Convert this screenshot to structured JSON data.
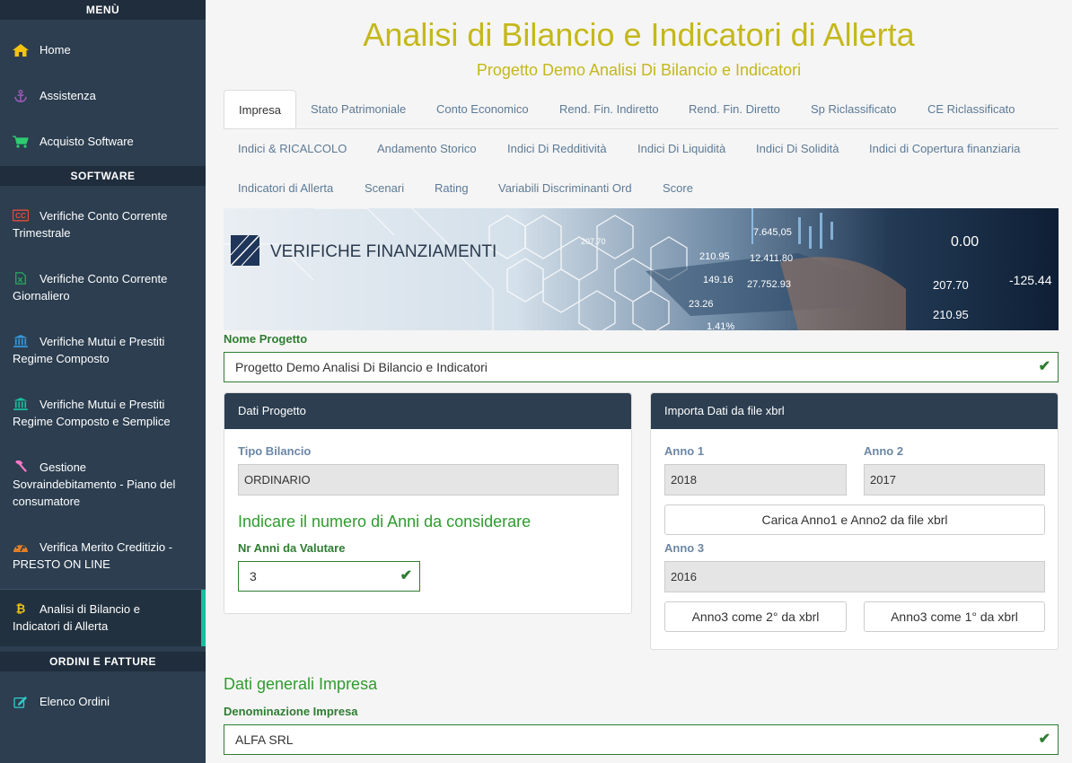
{
  "sidebar": {
    "menu_heading": "MENÙ",
    "software_heading": "SOFTWARE",
    "orders_heading": "ORDINI E FATTURE",
    "items": [
      {
        "label": "Home",
        "icon": "home-icon"
      },
      {
        "label": "Assistenza",
        "icon": "anchor-icon"
      },
      {
        "label": "Acquisto Software",
        "icon": "cart-icon"
      },
      {
        "label": "Verifiche Conto Corrente Trimestrale",
        "icon": "cc-icon"
      },
      {
        "label": "Verifiche Conto Corrente Giornaliero",
        "icon": "excel-icon"
      },
      {
        "label": "Verifiche Mutui e Prestiti Regime Composto",
        "icon": "bank-icon"
      },
      {
        "label": "Verifiche Mutui e Prestiti Regime Composto e Semplice",
        "icon": "bank-icon"
      },
      {
        "label": "Gestione Sovraindebitamento - Piano del consumatore",
        "icon": "gavel-icon"
      },
      {
        "label": "Verifica Merito Creditizio - PRESTO ON LINE",
        "icon": "dashboard-icon"
      },
      {
        "label": "Analisi di Bilancio e Indicatori di Allerta",
        "icon": "bitcoin-icon"
      },
      {
        "label": "Elenco Ordini",
        "icon": "edit-icon"
      }
    ]
  },
  "header": {
    "title": "Analisi di Bilancio e Indicatori di Allerta",
    "subtitle": "Progetto Demo Analisi Di Bilancio e Indicatori"
  },
  "tabs": [
    "Impresa",
    "Stato Patrimoniale",
    "Conto Economico",
    "Rend. Fin. Indiretto",
    "Rend. Fin. Diretto",
    "Sp Riclassificato",
    "CE Riclassificato",
    "Indici & RICALCOLO",
    "Andamento Storico",
    "Indici Di Redditività",
    "Indici Di Liquidità",
    "Indici Di Solidità",
    "Indici di Copertura finanziaria",
    "Indicatori di Allerta",
    "Scenari",
    "Rating",
    "Variabili Discriminanti Ord",
    "Score"
  ],
  "banner": {
    "brand": "VERIFICHE FINANZIAMENTI",
    "numbers": [
      "7.645,05",
      "0.00",
      "210.95",
      "12.411.80",
      "149.16",
      "27.752.93",
      "207.70",
      "210.95",
      "23.26",
      "1.41%",
      "207.70",
      "-125.44"
    ]
  },
  "project": {
    "name_label": "Nome Progetto",
    "name_value": "Progetto Demo Analisi Di Bilancio e Indicatori"
  },
  "dati_progetto": {
    "heading": "Dati Progetto",
    "tipo_label": "Tipo Bilancio",
    "tipo_value": "ORDINARIO",
    "anni_heading": "Indicare il numero di Anni da considerare",
    "nr_anni_label": "Nr Anni da Valutare",
    "nr_anni_value": "3"
  },
  "xbrl": {
    "heading": "Importa Dati da file xbrl",
    "anno1_label": "Anno 1",
    "anno1_value": "2018",
    "anno2_label": "Anno 2",
    "anno2_value": "2017",
    "load_button": "Carica Anno1 e Anno2 da file xbrl",
    "anno3_label": "Anno 3",
    "anno3_value": "2016",
    "anno3_second_button": "Anno3 come 2° da xbrl",
    "anno3_first_button": "Anno3 come 1° da xbrl"
  },
  "impresa": {
    "heading": "Dati generali Impresa",
    "denominazione_label": "Denominazione Impresa",
    "denominazione_value": "ALFA SRL"
  },
  "colors": {
    "sidebar_bg": "#2c3e50",
    "title_color": "#c4b81a",
    "accent_green": "#2e7d32",
    "active_marker": "#1abc9c"
  }
}
